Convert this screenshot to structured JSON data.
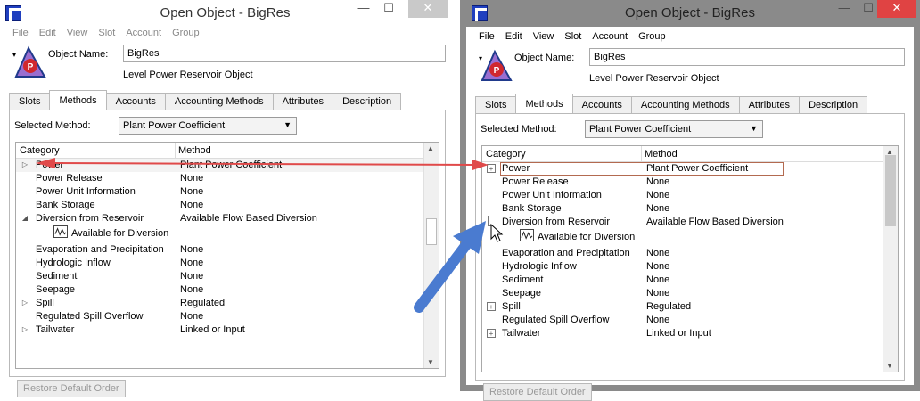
{
  "title": "Open Object - BigRes",
  "window_controls": {
    "minimize": "—",
    "maximize": "☐",
    "close": "✕"
  },
  "menu": [
    "File",
    "Edit",
    "View",
    "Slot",
    "Account",
    "Group"
  ],
  "object": {
    "name_label": "Object Name:",
    "name_value": "BigRes",
    "type": "Level Power Reservoir Object",
    "icon_letter": "P"
  },
  "tabs": [
    "Slots",
    "Methods",
    "Accounts",
    "Accounting Methods",
    "Attributes",
    "Description"
  ],
  "selected_method_label": "Selected Method:",
  "selected_method_value": "Plant Power Coefficient",
  "columns": {
    "category": "Category",
    "method": "Method"
  },
  "left_rows": [
    {
      "category": "Power",
      "method": "Plant Power Coefficient"
    },
    {
      "category": "Power Release",
      "method": "None"
    },
    {
      "category": "Power Unit Information",
      "method": "None"
    },
    {
      "category": "Bank Storage",
      "method": "None"
    },
    {
      "category": "Diversion from Reservoir",
      "method": "Available Flow Based Diversion"
    },
    {
      "category": "Available for Diversion",
      "method": ""
    },
    {
      "category": "Evaporation and Precipitation",
      "method": "None"
    },
    {
      "category": "Hydrologic Inflow",
      "method": "None"
    },
    {
      "category": "Sediment",
      "method": "None"
    },
    {
      "category": "Seepage",
      "method": "None"
    },
    {
      "category": "Spill",
      "method": "Regulated"
    },
    {
      "category": "Regulated Spill Overflow",
      "method": "None"
    },
    {
      "category": "Tailwater",
      "method": "Linked or Input"
    }
  ],
  "right_rows": [
    {
      "category": "Power",
      "method": "Plant Power Coefficient"
    },
    {
      "category": "Power Release",
      "method": "None"
    },
    {
      "category": "Power Unit Information",
      "method": "None"
    },
    {
      "category": "Bank Storage",
      "method": "None"
    },
    {
      "category": "Diversion from Reservoir",
      "method": "Available Flow Based Diversion"
    },
    {
      "category": "Available for Diversion",
      "method": ""
    },
    {
      "category": "Evaporation and Precipitation",
      "method": "None"
    },
    {
      "category": "Hydrologic Inflow",
      "method": "None"
    },
    {
      "category": "Sediment",
      "method": "None"
    },
    {
      "category": "Seepage",
      "method": "None"
    },
    {
      "category": "Spill",
      "method": "Regulated"
    },
    {
      "category": "Regulated Spill Overflow",
      "method": "None"
    },
    {
      "category": "Tailwater",
      "method": "Linked or Input"
    }
  ],
  "restore_button": "Restore Default Order",
  "colors": {
    "red_arrow": "#e04a4a",
    "blue_arrow": "#4a7bd0",
    "accent": "#1f3fbf"
  }
}
